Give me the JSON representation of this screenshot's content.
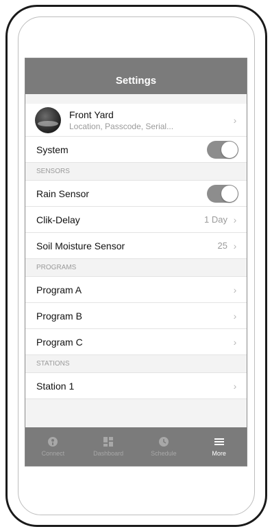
{
  "header": {
    "title": "Settings"
  },
  "profile": {
    "name": "Front Yard",
    "subtitle": "Location, Passcode, Serial..."
  },
  "system": {
    "label": "System",
    "enabled": true
  },
  "sensors": {
    "section_title": "SENSORS",
    "rain_sensor": {
      "label": "Rain Sensor",
      "enabled": true
    },
    "clik_delay": {
      "label": "Clik-Delay",
      "value": "1 Day"
    },
    "soil_moisture": {
      "label": "Soil Moisture Sensor",
      "value": "25"
    }
  },
  "programs": {
    "section_title": "PROGRAMS",
    "items": [
      {
        "label": "Program A"
      },
      {
        "label": "Program B"
      },
      {
        "label": "Program C"
      }
    ]
  },
  "stations": {
    "section_title": "STATIONS",
    "items": [
      {
        "label": "Station 1"
      }
    ]
  },
  "tabbar": {
    "items": [
      {
        "label": "Connect",
        "icon": "connect-icon",
        "active": false
      },
      {
        "label": "Dashboard",
        "icon": "dashboard-icon",
        "active": false
      },
      {
        "label": "Schedule",
        "icon": "clock-icon",
        "active": false
      },
      {
        "label": "More",
        "icon": "menu-icon",
        "active": true
      }
    ]
  },
  "colors": {
    "bar": "#7b7b7b",
    "toggle_on": "#8d8d8d",
    "background": "#f3f3f3"
  }
}
